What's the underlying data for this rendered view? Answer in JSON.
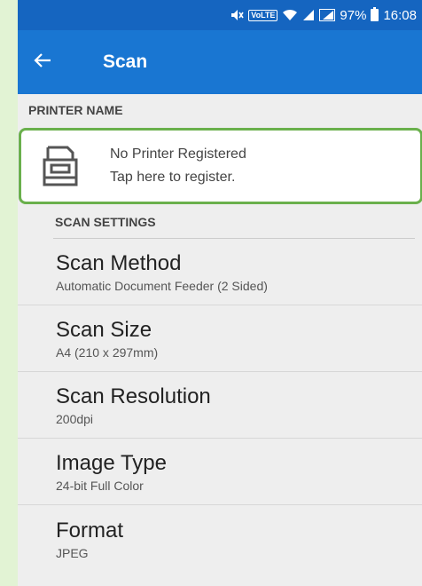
{
  "statusbar": {
    "volte": "VoLTE",
    "battery": "97%",
    "time": "16:08"
  },
  "appbar": {
    "title": "Scan"
  },
  "printer": {
    "header": "PRINTER NAME",
    "line1": "No Printer Registered",
    "line2": "Tap here to register."
  },
  "settings": {
    "header": "SCAN SETTINGS",
    "items": [
      {
        "title": "Scan Method",
        "value": "Automatic Document Feeder (2 Sided)"
      },
      {
        "title": "Scan Size",
        "value": "A4 (210 x 297mm)"
      },
      {
        "title": "Scan Resolution",
        "value": "200dpi"
      },
      {
        "title": "Image Type",
        "value": "24-bit Full Color"
      },
      {
        "title": "Format",
        "value": "JPEG"
      }
    ]
  },
  "colors": {
    "statusbar": "#1565c0",
    "appbar": "#1976d2",
    "highlight_border": "#6ab04c",
    "outer_background": "#e2f3d4"
  }
}
